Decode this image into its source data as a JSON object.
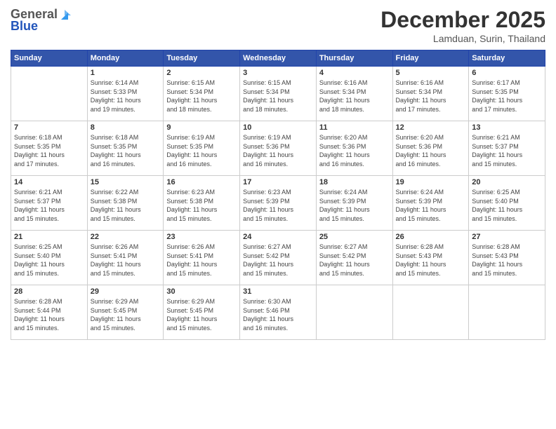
{
  "header": {
    "logo_general": "General",
    "logo_blue": "Blue",
    "month": "December 2025",
    "location": "Lamduan, Surin, Thailand"
  },
  "weekdays": [
    "Sunday",
    "Monday",
    "Tuesday",
    "Wednesday",
    "Thursday",
    "Friday",
    "Saturday"
  ],
  "weeks": [
    [
      {
        "day": "",
        "info": ""
      },
      {
        "day": "1",
        "info": "Sunrise: 6:14 AM\nSunset: 5:33 PM\nDaylight: 11 hours\nand 19 minutes."
      },
      {
        "day": "2",
        "info": "Sunrise: 6:15 AM\nSunset: 5:34 PM\nDaylight: 11 hours\nand 18 minutes."
      },
      {
        "day": "3",
        "info": "Sunrise: 6:15 AM\nSunset: 5:34 PM\nDaylight: 11 hours\nand 18 minutes."
      },
      {
        "day": "4",
        "info": "Sunrise: 6:16 AM\nSunset: 5:34 PM\nDaylight: 11 hours\nand 18 minutes."
      },
      {
        "day": "5",
        "info": "Sunrise: 6:16 AM\nSunset: 5:34 PM\nDaylight: 11 hours\nand 17 minutes."
      },
      {
        "day": "6",
        "info": "Sunrise: 6:17 AM\nSunset: 5:35 PM\nDaylight: 11 hours\nand 17 minutes."
      }
    ],
    [
      {
        "day": "7",
        "info": "Sunrise: 6:18 AM\nSunset: 5:35 PM\nDaylight: 11 hours\nand 17 minutes."
      },
      {
        "day": "8",
        "info": "Sunrise: 6:18 AM\nSunset: 5:35 PM\nDaylight: 11 hours\nand 16 minutes."
      },
      {
        "day": "9",
        "info": "Sunrise: 6:19 AM\nSunset: 5:35 PM\nDaylight: 11 hours\nand 16 minutes."
      },
      {
        "day": "10",
        "info": "Sunrise: 6:19 AM\nSunset: 5:36 PM\nDaylight: 11 hours\nand 16 minutes."
      },
      {
        "day": "11",
        "info": "Sunrise: 6:20 AM\nSunset: 5:36 PM\nDaylight: 11 hours\nand 16 minutes."
      },
      {
        "day": "12",
        "info": "Sunrise: 6:20 AM\nSunset: 5:36 PM\nDaylight: 11 hours\nand 16 minutes."
      },
      {
        "day": "13",
        "info": "Sunrise: 6:21 AM\nSunset: 5:37 PM\nDaylight: 11 hours\nand 15 minutes."
      }
    ],
    [
      {
        "day": "14",
        "info": "Sunrise: 6:21 AM\nSunset: 5:37 PM\nDaylight: 11 hours\nand 15 minutes."
      },
      {
        "day": "15",
        "info": "Sunrise: 6:22 AM\nSunset: 5:38 PM\nDaylight: 11 hours\nand 15 minutes."
      },
      {
        "day": "16",
        "info": "Sunrise: 6:23 AM\nSunset: 5:38 PM\nDaylight: 11 hours\nand 15 minutes."
      },
      {
        "day": "17",
        "info": "Sunrise: 6:23 AM\nSunset: 5:39 PM\nDaylight: 11 hours\nand 15 minutes."
      },
      {
        "day": "18",
        "info": "Sunrise: 6:24 AM\nSunset: 5:39 PM\nDaylight: 11 hours\nand 15 minutes."
      },
      {
        "day": "19",
        "info": "Sunrise: 6:24 AM\nSunset: 5:39 PM\nDaylight: 11 hours\nand 15 minutes."
      },
      {
        "day": "20",
        "info": "Sunrise: 6:25 AM\nSunset: 5:40 PM\nDaylight: 11 hours\nand 15 minutes."
      }
    ],
    [
      {
        "day": "21",
        "info": "Sunrise: 6:25 AM\nSunset: 5:40 PM\nDaylight: 11 hours\nand 15 minutes."
      },
      {
        "day": "22",
        "info": "Sunrise: 6:26 AM\nSunset: 5:41 PM\nDaylight: 11 hours\nand 15 minutes."
      },
      {
        "day": "23",
        "info": "Sunrise: 6:26 AM\nSunset: 5:41 PM\nDaylight: 11 hours\nand 15 minutes."
      },
      {
        "day": "24",
        "info": "Sunrise: 6:27 AM\nSunset: 5:42 PM\nDaylight: 11 hours\nand 15 minutes."
      },
      {
        "day": "25",
        "info": "Sunrise: 6:27 AM\nSunset: 5:42 PM\nDaylight: 11 hours\nand 15 minutes."
      },
      {
        "day": "26",
        "info": "Sunrise: 6:28 AM\nSunset: 5:43 PM\nDaylight: 11 hours\nand 15 minutes."
      },
      {
        "day": "27",
        "info": "Sunrise: 6:28 AM\nSunset: 5:43 PM\nDaylight: 11 hours\nand 15 minutes."
      }
    ],
    [
      {
        "day": "28",
        "info": "Sunrise: 6:28 AM\nSunset: 5:44 PM\nDaylight: 11 hours\nand 15 minutes."
      },
      {
        "day": "29",
        "info": "Sunrise: 6:29 AM\nSunset: 5:45 PM\nDaylight: 11 hours\nand 15 minutes."
      },
      {
        "day": "30",
        "info": "Sunrise: 6:29 AM\nSunset: 5:45 PM\nDaylight: 11 hours\nand 15 minutes."
      },
      {
        "day": "31",
        "info": "Sunrise: 6:30 AM\nSunset: 5:46 PM\nDaylight: 11 hours\nand 16 minutes."
      },
      {
        "day": "",
        "info": ""
      },
      {
        "day": "",
        "info": ""
      },
      {
        "day": "",
        "info": ""
      }
    ]
  ]
}
